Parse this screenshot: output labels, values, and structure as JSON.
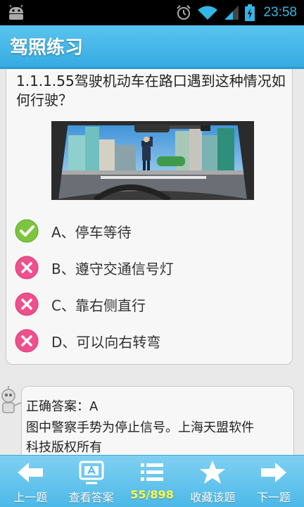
{
  "status_bar": {
    "time": "23:58",
    "icons": [
      "android-icon",
      "alarm-icon",
      "wifi-icon",
      "signal-icon",
      "battery-charging-icon"
    ],
    "accent_color": "#33b5e5"
  },
  "header": {
    "title": "驾照练习",
    "color": "#45b7e8"
  },
  "question": {
    "text": "1.1.1.55驾驶机动车在路口遇到这种情况如何行驶？",
    "image": "police-officer-stop-signal-intersection-scene",
    "options": [
      {
        "label": "A、停车等待",
        "state": "correct",
        "icon": "check-icon"
      },
      {
        "label": "B、遵守交通信号灯",
        "state": "wrong",
        "icon": "cross-icon"
      },
      {
        "label": "C、靠右侧直行",
        "state": "wrong",
        "icon": "cross-icon"
      },
      {
        "label": "D、可以向右转弯",
        "state": "wrong",
        "icon": "cross-icon"
      }
    ]
  },
  "answer": {
    "correct_line": "正确答案：A",
    "explanation_line1": "图中警察手势为停止信号。上海天盟软件",
    "explanation_line2": "科技版权所有"
  },
  "toolbar": {
    "prev_label": "上一题",
    "view_answer_label": "查看答案",
    "progress": "55/898",
    "favorite_label": "收藏该题",
    "next_label": "下一题",
    "progress_color": "#fffb4a"
  }
}
